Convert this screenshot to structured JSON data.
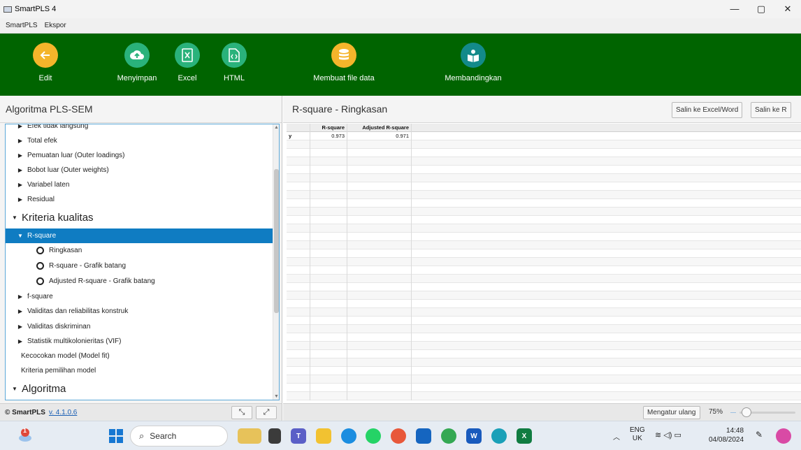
{
  "window": {
    "title": "SmartPLS 4",
    "controls": [
      "—",
      "▢",
      "✕"
    ]
  },
  "menu": [
    "SmartPLS",
    "Ekspor"
  ],
  "toolbar": {
    "edit": "Edit",
    "save": "Menyimpan",
    "excel": "Excel",
    "html": "HTML",
    "datafile": "Membuat file data",
    "compare": "Membandingkan"
  },
  "left_panel": {
    "title": "Algoritma PLS-SEM",
    "tree": [
      {
        "label": "Efek tidak langsung",
        "level": 1,
        "type": "arrow",
        "cut": true
      },
      {
        "label": "Total efek",
        "level": 1,
        "type": "arrow"
      },
      {
        "label": "Pemuatan luar (Outer loadings)",
        "level": 1,
        "type": "arrow"
      },
      {
        "label": "Bobot luar (Outer weights)",
        "level": 1,
        "type": "arrow"
      },
      {
        "label": "Variabel laten",
        "level": 1,
        "type": "arrow"
      },
      {
        "label": "Residual",
        "level": 1,
        "type": "arrow"
      },
      {
        "label": "Kriteria kualitas",
        "level": 0,
        "type": "open-big"
      },
      {
        "label": "R-square",
        "level": 1,
        "type": "open",
        "selected": true
      },
      {
        "label": "Ringkasan",
        "level": 2,
        "type": "radio"
      },
      {
        "label": "R-square - Grafik batang",
        "level": 2,
        "type": "radio"
      },
      {
        "label": "Adjusted R-square - Grafik batang",
        "level": 2,
        "type": "radio"
      },
      {
        "label": "f-square",
        "level": 1,
        "type": "arrow"
      },
      {
        "label": "Validitas dan reliabilitas konstruk",
        "level": 1,
        "type": "arrow"
      },
      {
        "label": "Validitas diskriminan",
        "level": 1,
        "type": "arrow"
      },
      {
        "label": "Statistik multikolonieritas (VIF)",
        "level": 1,
        "type": "arrow"
      },
      {
        "label": "Kecocokan model (Model fit)",
        "level": 1,
        "type": "leaf"
      },
      {
        "label": "Kriteria pemilihan model",
        "level": 1,
        "type": "leaf"
      },
      {
        "label": "Algoritma",
        "level": 0,
        "type": "open-big"
      }
    ],
    "footer": {
      "brand": "© SmartPLS",
      "version": "v. 4.1.0.6"
    }
  },
  "right_panel": {
    "title": "R-square - Ringkasan",
    "copy_excel": "Salin ke Excel/Word",
    "copy_r": "Salin ke R",
    "table": {
      "headers": [
        "",
        "R-square",
        "Adjusted R-square"
      ],
      "rows": [
        [
          "y",
          "0.973",
          "0.971"
        ]
      ]
    },
    "footer": {
      "reset": "Mengatur ulang",
      "zoom": "75%"
    }
  },
  "taskbar": {
    "search": "Search",
    "lang": "ENG",
    "region": "UK",
    "time": "14:48",
    "date": "04/08/2024",
    "weather_badge": "1"
  }
}
